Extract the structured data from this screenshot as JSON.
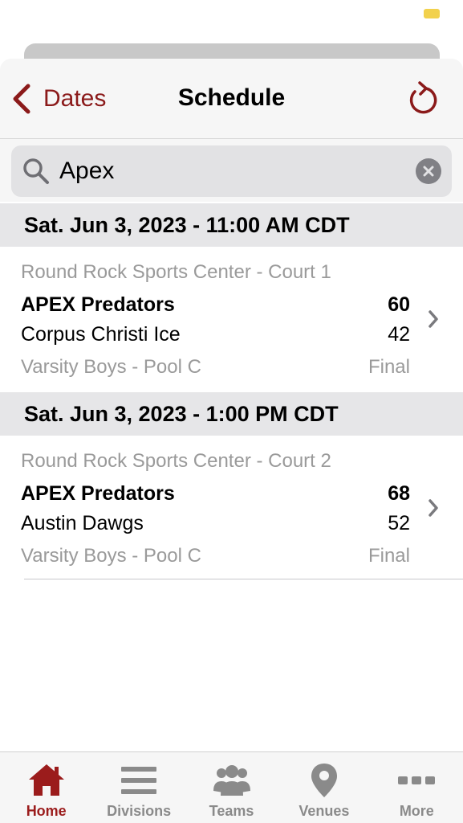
{
  "colors": {
    "accent": "#8b1a1a",
    "battery": "#f2d14c",
    "muted": "#9a9a9a",
    "header_bg": "#e6e6e8"
  },
  "navbar": {
    "back_label": "Dates",
    "title": "Schedule",
    "back_icon": "chevron-left-icon",
    "refresh_icon": "refresh-icon"
  },
  "search": {
    "value": "Apex",
    "icon": "search-icon",
    "clear_icon": "clear-icon"
  },
  "sections": [
    {
      "header": "Sat. Jun 3, 2023 - 11:00 AM CDT",
      "game": {
        "venue": "Round Rock Sports Center - Court 1",
        "team1": "APEX Predators",
        "score1": "60",
        "team2": "Corpus Christi Ice",
        "score2": "42",
        "division": "Varsity Boys - Pool C",
        "status": "Final"
      }
    },
    {
      "header": "Sat. Jun 3, 2023 - 1:00 PM CDT",
      "game": {
        "venue": "Round Rock Sports Center - Court 2",
        "team1": "APEX Predators",
        "score1": "68",
        "team2": "Austin Dawgs",
        "score2": "52",
        "division": "Varsity Boys - Pool C",
        "status": "Final"
      }
    }
  ],
  "tabbar": {
    "items": [
      {
        "label": "Home",
        "icon": "home-icon",
        "active": true
      },
      {
        "label": "Divisions",
        "icon": "list-icon",
        "active": false
      },
      {
        "label": "Teams",
        "icon": "group-icon",
        "active": false
      },
      {
        "label": "Venues",
        "icon": "location-pin-icon",
        "active": false
      },
      {
        "label": "More",
        "icon": "more-icon",
        "active": false
      }
    ]
  }
}
